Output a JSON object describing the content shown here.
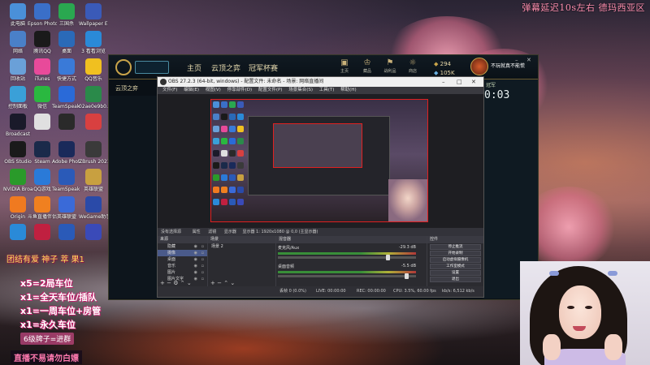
{
  "desktop": {
    "icons": [
      {
        "label": "此电脑",
        "color": "#4a90d9"
      },
      {
        "label": "Epson Photo+",
        "color": "#3a6fc8"
      },
      {
        "label": "三国杀",
        "color": "#2aa850"
      },
      {
        "label": "Wallpaper Engine",
        "color": "#3a5ab8"
      },
      {
        "label": "网络",
        "color": "#4a80c8"
      },
      {
        "label": "腾讯QQ",
        "color": "#1a1a1a"
      },
      {
        "label": "桌面",
        "color": "#2a6ab8"
      },
      {
        "label": "3 看看浏览",
        "color": "#2a8ad8"
      },
      {
        "label": "回收站",
        "color": "#6aa0d8"
      },
      {
        "label": "iTunes",
        "color": "#e84a9a"
      },
      {
        "label": "快捷方式",
        "color": "#3a7ad8"
      },
      {
        "label": "QQ音乐",
        "color": "#f0c020"
      },
      {
        "label": "控制面板",
        "color": "#3aa0d8"
      },
      {
        "label": "微信",
        "color": "#2ab840"
      },
      {
        "label": "TeamSpeak 3 Client",
        "color": "#2a6ad8"
      },
      {
        "label": "02ae0e9b0...",
        "color": "#2a8a4a"
      },
      {
        "label": "Broadcast",
        "color": "#1a1a2a"
      },
      {
        "label": "",
        "color": "#e0e0e0"
      },
      {
        "label": "",
        "color": "#2a2a2a"
      },
      {
        "label": "",
        "color": "#d84040"
      },
      {
        "label": "OBS Studio",
        "color": "#1a1a1a"
      },
      {
        "label": "Steam",
        "color": "#1a2a4a"
      },
      {
        "label": "Adobe Photosh...",
        "color": "#1a2a5a"
      },
      {
        "label": "ZBrush 2021",
        "color": "#3a3a3a"
      },
      {
        "label": "NVIDIA Broadcast",
        "color": "#2a9a2a"
      },
      {
        "label": "QQ游戏",
        "color": "#2a7ad8"
      },
      {
        "label": "TeamSpeak 3 Client",
        "color": "#2a5ab8"
      },
      {
        "label": "英雄联盟",
        "color": "#c8a040"
      },
      {
        "label": "Origin",
        "color": "#f07a20"
      },
      {
        "label": "斗鱼直播伴侣",
        "color": "#f08020"
      },
      {
        "label": "英雄联盟",
        "color": "#3a6ad8"
      },
      {
        "label": "WeGame助手",
        "color": "#2a4aa8"
      },
      {
        "label": "",
        "color": "#2a8ad8"
      },
      {
        "label": "",
        "color": "#c02040"
      },
      {
        "label": "",
        "color": "#2a5ab8"
      },
      {
        "label": "",
        "color": "#3a4ab8"
      }
    ],
    "top_banner": "弹幕延迟10s左右  德玛西亚区"
  },
  "lol_client": {
    "nav": [
      "主页",
      "云顶之弈",
      "冠军杯赛"
    ],
    "tools": [
      {
        "glyph": "▣",
        "label": "主页"
      },
      {
        "glyph": "♔",
        "label": "藏品"
      },
      {
        "glyph": "⚑",
        "label": "战利品"
      },
      {
        "glyph": "☼",
        "label": "商店"
      }
    ],
    "rp": "294",
    "be": "105K",
    "currency_icons": [
      "rp-icon",
      "blue-essence-icon"
    ],
    "summoner_name": "不玩就真不能慌",
    "sub_title": "云顶之弈",
    "timer": "0:03",
    "right_label": "冠军"
  },
  "obs": {
    "title": "OBS 27.2.3 (64-bit, windows) - 配置文件: 未命名 - 场景: 网络直播间",
    "menu": [
      "文件(F)",
      "编辑(E)",
      "视图(V)",
      "停靠部件(D)",
      "配置文件(P)",
      "场景集合(S)",
      "工具(T)",
      "帮助(H)"
    ],
    "source_bar": [
      "没有选择源",
      "属性",
      "滤镜",
      "显示器",
      "显示器 1: 1920x1080 @ 0,0 (主显示器)"
    ],
    "panels": {
      "scenes_title": "来源",
      "scenes": [
        "隐藏",
        "摄像",
        "桌面",
        "音乐",
        "图片",
        "图片文字"
      ],
      "selected_scene": 1,
      "sources_title": "场景",
      "sources": [
        "场景 2"
      ],
      "mixer_title": "混音器",
      "mixer": [
        {
          "name": "麦克风/Aux",
          "db": "-29.3 dB",
          "level": 0.78
        },
        {
          "name": "桌面音频",
          "db": "-5.5 dB",
          "level": 0.92
        }
      ],
      "controls_title": "控件",
      "controls": [
        "停止推流",
        "开始录制",
        "启动虚拟摄像机",
        "工作室模式",
        "设置",
        "退出"
      ]
    },
    "status": {
      "live": "LIVE: 00:00:00",
      "rec": "REC: 00:00:00",
      "cpu": "CPU: 3.5%, 60.00 fps",
      "dropped": "丢帧 0 (0.0%)",
      "kbps": "kb/s: 6,512 kb/s"
    }
  },
  "overlay": {
    "fan_tag": "团结有爱 神子 萃 果1",
    "rules": [
      "x5=2局车位",
      "x1=全天车位/插队",
      "x1=一周车位+房管",
      "x1=永久车位"
    ],
    "join": "6级牌子=进群",
    "slogan": "直播不易请勿白嫖"
  }
}
